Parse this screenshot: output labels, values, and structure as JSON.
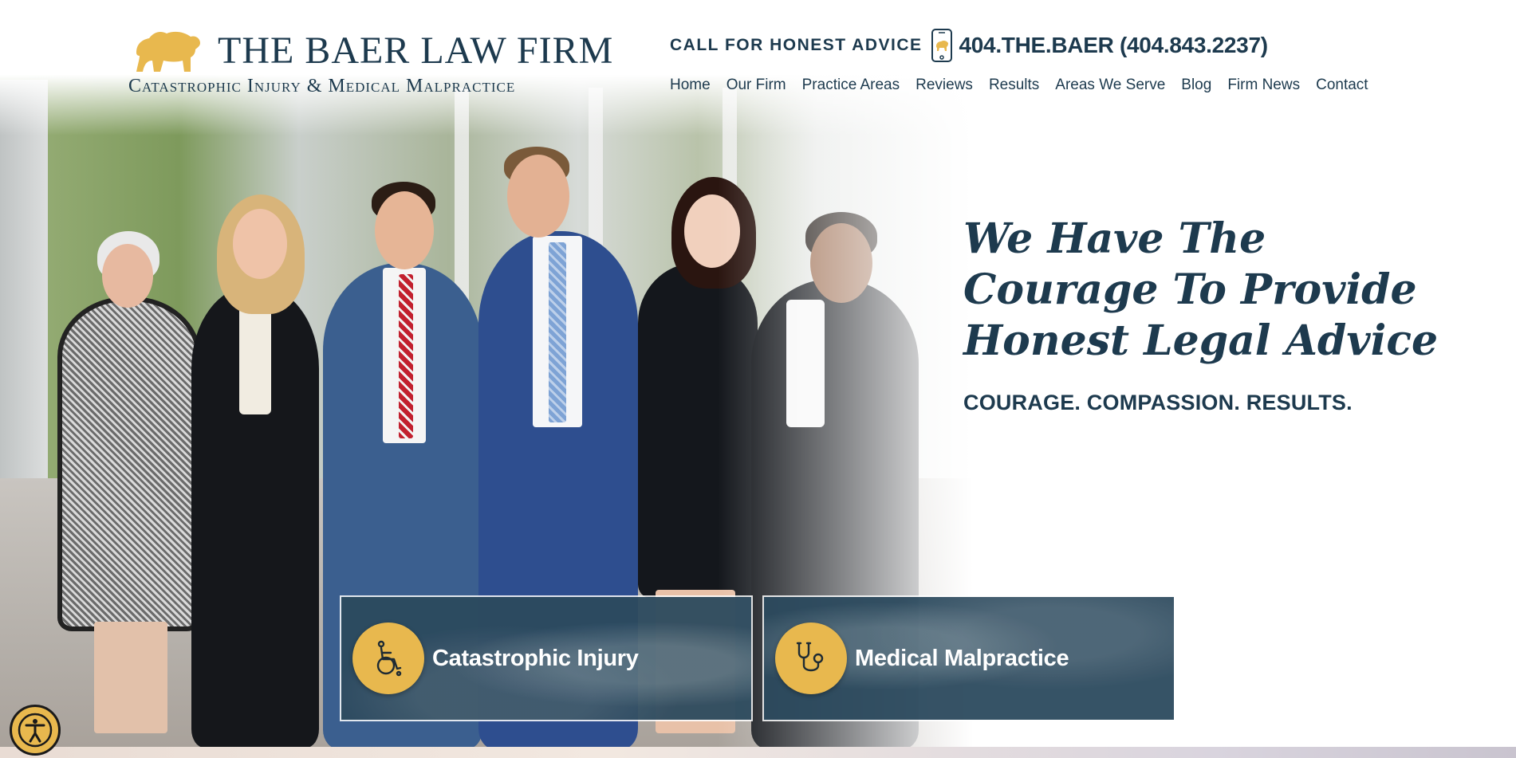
{
  "brand": {
    "firm_name": "THE BAER LAW FIRM",
    "tagline": "Catastrophic Injury & Medical Malpractice",
    "logo_icon": "bear-icon",
    "accent_color": "#e8b84e",
    "primary_color": "#1d3a4e"
  },
  "header": {
    "call_label": "CALL FOR HONEST ADVICE",
    "phone_icon": "smartphone-icon",
    "phone_number": "404.THE.BAER (404.843.2237)"
  },
  "nav": {
    "items": [
      {
        "label": "Home"
      },
      {
        "label": "Our Firm"
      },
      {
        "label": "Practice Areas"
      },
      {
        "label": "Reviews"
      },
      {
        "label": "Results"
      },
      {
        "label": "Areas We Serve"
      },
      {
        "label": "Blog"
      },
      {
        "label": "Firm News"
      },
      {
        "label": "Contact"
      }
    ]
  },
  "hero": {
    "headline_lines": [
      "We Have The",
      "Courage To Provide",
      "Honest Legal Advice"
    ],
    "subheadline": "COURAGE. COMPASSION. RESULTS."
  },
  "practice_cards": [
    {
      "label": "Catastrophic Injury",
      "icon": "wheelchair-icon"
    },
    {
      "label": "Medical Malpractice",
      "icon": "stethoscope-icon"
    }
  ],
  "accessibility": {
    "icon": "accessibility-icon"
  }
}
